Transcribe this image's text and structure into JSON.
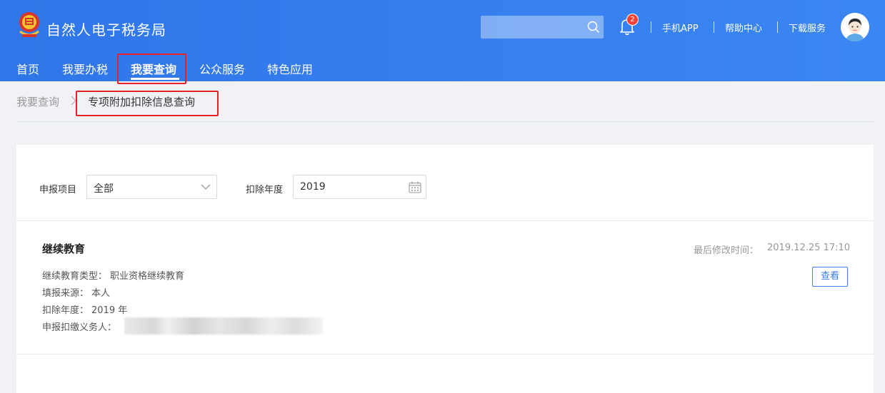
{
  "header": {
    "title": "自然人电子税务局",
    "search_placeholder": "",
    "notification_count": "2",
    "links": [
      "手机APP",
      "帮助中心",
      "下载服务"
    ]
  },
  "nav": {
    "items": [
      "首页",
      "我要办税",
      "我要查询",
      "公众服务",
      "特色应用"
    ],
    "active": "我要查询"
  },
  "breadcrumb": {
    "root": "我要查询",
    "current": "专项附加扣除信息查询"
  },
  "filters": {
    "project_label": "申报项目",
    "project_value": "全部",
    "year_label": "扣除年度",
    "year_value": "2019"
  },
  "record": {
    "title": "继续教育",
    "modified_label": "最后修改时间：",
    "modified_value": "2019.12.25 17:10",
    "view_label": "查看",
    "fields": [
      {
        "label": "继续教育类型：",
        "value": "职业资格继续教育"
      },
      {
        "label": "填报来源：",
        "value": "本人"
      },
      {
        "label": "扣除年度：",
        "value": "2019 年"
      },
      {
        "label": "申报扣缴义务人：",
        "value": ""
      }
    ]
  },
  "colors": {
    "header_blue": "#3780ef",
    "highlight_red": "#e8202a",
    "button_blue": "#3d7fe6"
  }
}
